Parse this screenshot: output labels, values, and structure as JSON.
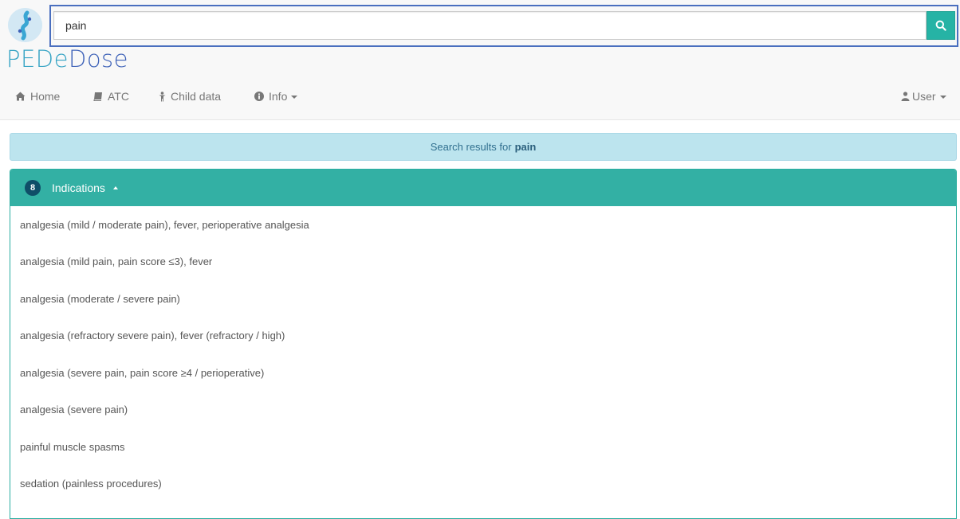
{
  "search": {
    "value": "pain",
    "button_icon": "search-icon"
  },
  "brand": {
    "part1": "PEDe",
    "part2": "Dose"
  },
  "nav": {
    "home": "Home",
    "atc": "ATC",
    "child_data": "Child data",
    "info": "Info",
    "user": "User"
  },
  "alert": {
    "prefix": "Search results for",
    "term": "pain"
  },
  "indications": {
    "count": "8",
    "title": "Indications",
    "items": [
      "analgesia (mild / moderate pain), fever, perioperative analgesia",
      "analgesia (mild pain, pain score ≤3), fever",
      "analgesia (moderate / severe pain)",
      "analgesia (refractory severe pain), fever (refractory / high)",
      "analgesia (severe pain, pain score ≥4 / perioperative)",
      "analgesia (severe pain)",
      "painful muscle spasms",
      "sedation (painless procedures)"
    ]
  },
  "colors": {
    "accent": "#33b0a4",
    "alert_bg": "#bce4ee",
    "badge_bg": "#0f4e68",
    "search_highlight": "#4a6fbf"
  }
}
